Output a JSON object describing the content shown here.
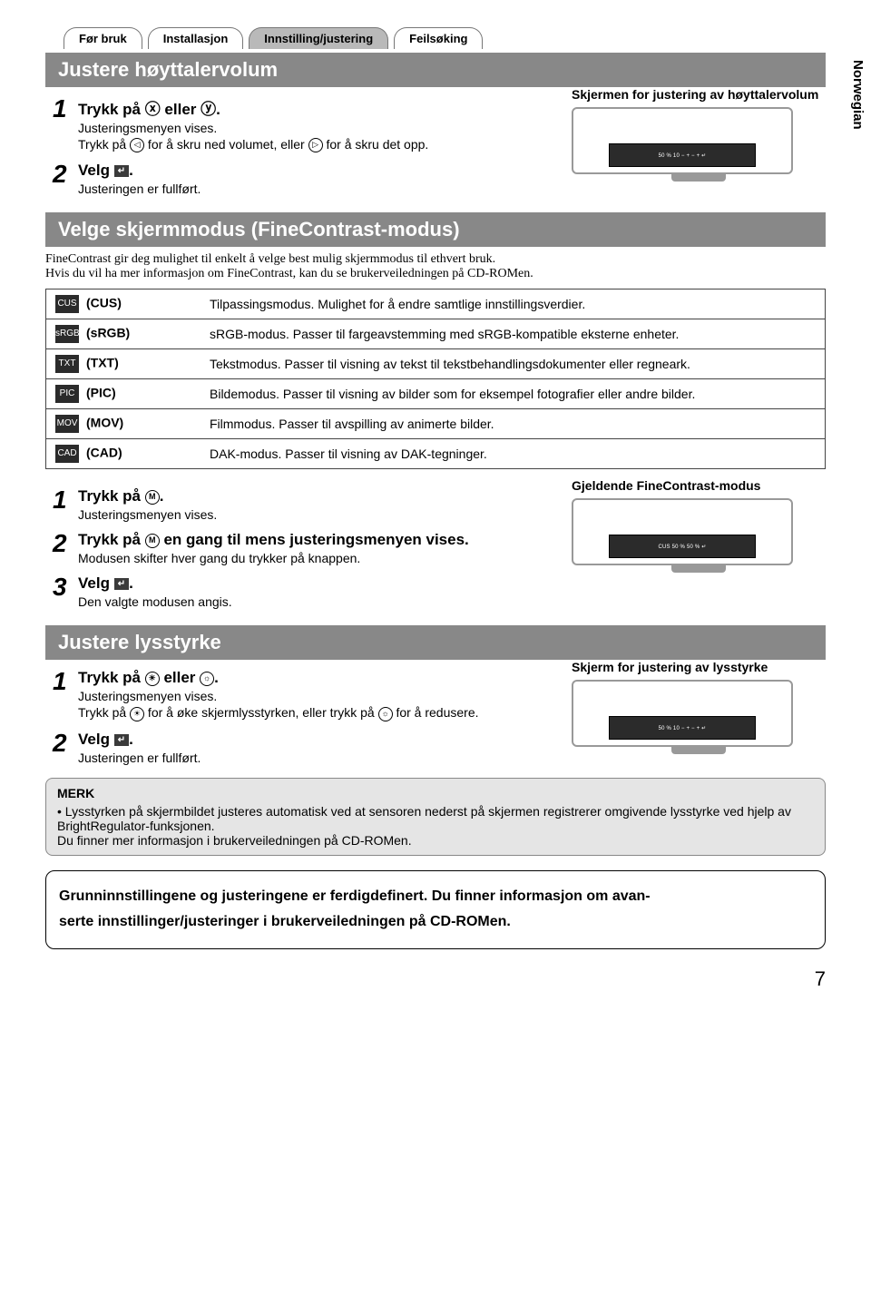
{
  "tabs": {
    "t0": "Før bruk",
    "t1": "Installasjon",
    "t2": "Innstilling/justering",
    "t3": "Feilsøking"
  },
  "sideLabel": "Norwegian",
  "sec1": {
    "title": "Justere høyttalervolum",
    "step1_title": "Trykk på ⓧ eller ⓨ.",
    "step1_b": "Justeringsmenyen vises.",
    "step1_c_a": "Trykk på ",
    "step1_c_b": " for å skru ned volumet, eller ",
    "step1_c_c": " for å skru det opp.",
    "step2_title_a": "Velg ",
    "step2_title_b": ".",
    "step2_b": "Justeringen er fullført.",
    "screenLabel": "Skjermen for justering av høyttalervolum",
    "osd": "50 % 10 − + − + ↵"
  },
  "sec2": {
    "title": "Velge skjermmodus (FineContrast-modus)",
    "intro": "FineContrast gir deg mulighet til enkelt å velge best mulig skjermmodus til ethvert bruk.\nHvis du vil ha mer informasjon om FineContrast, kan du se brukerveiledningen på CD-ROMen.",
    "modes": {
      "cus": {
        "label": "(CUS)",
        "desc": "Tilpassingsmodus. Mulighet for å endre samtlige innstillingsverdier."
      },
      "srgb": {
        "label": "(sRGB)",
        "desc": "sRGB-modus. Passer til fargeavstemming med sRGB-kompatible eksterne enheter."
      },
      "txt": {
        "label": "(TXT)",
        "desc": "Tekstmodus. Passer til visning av tekst til tekstbehandlingsdokumenter eller regneark."
      },
      "pic": {
        "label": "(PIC)",
        "desc": "Bildemodus. Passer til visning av bilder som for eksempel fotografier eller andre bilder."
      },
      "mov": {
        "label": "(MOV)",
        "desc": "Filmmodus. Passer til avspilling av animerte bilder."
      },
      "cad": {
        "label": "(CAD)",
        "desc": "DAK-modus. Passer til visning av DAK-tegninger."
      }
    },
    "step1_a": "Trykk på ",
    "step1_b": ".",
    "step1_c": "Justeringsmenyen vises.",
    "step2_a": "Trykk på ",
    "step2_b": " en gang til mens justeringsmenyen vises.",
    "step2_c": "Modusen skifter hver gang du trykker på knappen.",
    "step3_a": "Velg ",
    "step3_b": ".",
    "step3_c": "Den valgte modusen angis.",
    "screenLabel": "Gjeldende FineContrast-modus",
    "osd": "CUS 50 % 50 % ↵"
  },
  "sec3": {
    "title": "Justere lysstyrke",
    "step1_a": "Trykk på ",
    "step1_b": " eller ",
    "step1_c": ".",
    "step1_d": "Justeringsmenyen vises.",
    "step1_e_a": "Trykk på ",
    "step1_e_b": " for å øke skjermlysstyrken, eller trykk på ",
    "step1_e_c": " for å redusere.",
    "step2_a": "Velg ",
    "step2_b": ".",
    "step2_c": "Justeringen er fullført.",
    "screenLabel": "Skjerm for justering av lysstyrke",
    "osd": "50 % 10 − + − + ↵"
  },
  "note": {
    "title": "MERK",
    "body": "Lysstyrken på skjermbildet justeres automatisk ved at sensoren nederst på skjermen registrerer omgivende lysstyrke ved hjelp av BrightRegulator-funksjonen.\nDu finner mer informasjon i brukerveiledningen på CD-ROMen."
  },
  "final": "Grunninnstillingene og justeringene er ferdigdefinert. Du finner informasjon om avan-\nserte innstillinger/justeringer i brukerveiledningen på CD-ROMen.",
  "pageNum": "7",
  "icons": {
    "volDown": "ⓧ",
    "volUp": "ⓨ",
    "enter": "↵",
    "mode": "M",
    "sunUp": "☀",
    "sunDown": "☀"
  }
}
